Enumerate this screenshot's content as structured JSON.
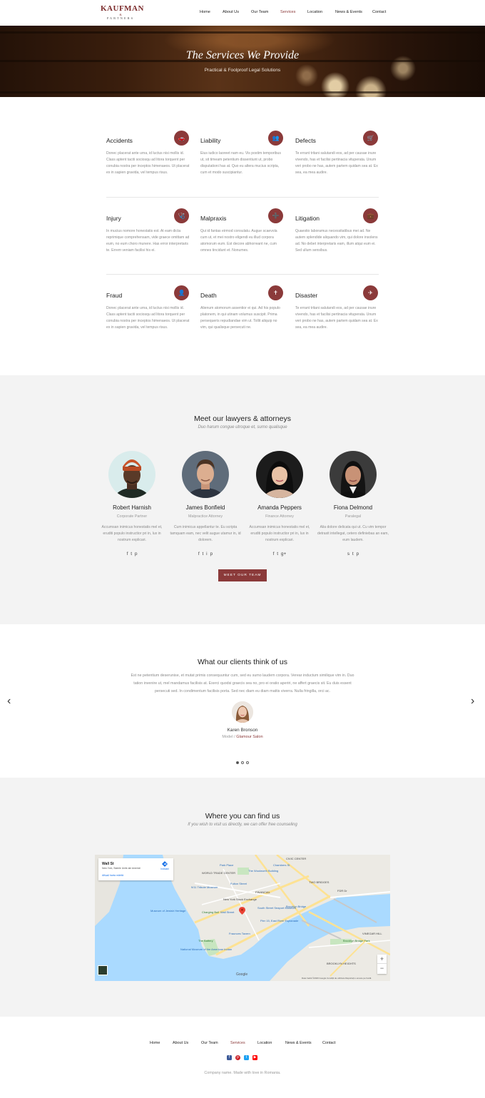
{
  "brand": {
    "name": "KAUFMAN",
    "amp": "&",
    "sub": "PARTNERS",
    "accent": "#8b3a3a"
  },
  "nav": [
    "Home",
    "About Us",
    "Our Team",
    "Services",
    "Location",
    "News & Events",
    "Contact"
  ],
  "nav_active": "Services",
  "hero": {
    "title": "The Services We Provide",
    "subtitle": "Practical & Foolproof Legal Solutions"
  },
  "services": [
    {
      "title": "Accidents",
      "icon": "car-icon",
      "glyph": "🚗",
      "desc": "Donec placerat ante urna, id luctus nisi mollis id. Class aptent taciti sociosqu ad litora torquent per conubia nostra per inceptos himenaeos. Ut placerat ex in sapien gravida, vel tempus risus."
    },
    {
      "title": "Liability",
      "icon": "people-icon",
      "glyph": "👥",
      "desc": "Eius iudico laoreet nam eu. Vis postim temporibus ut, sit timeam petentium dissentiunt ut, probo disputationi has at. Quo eu altera mucius scripta, cum et modo suscipiantur."
    },
    {
      "title": "Defects",
      "icon": "cart-icon",
      "glyph": "🛒",
      "desc": "Te errant tritani salutandi eos, ad per causae inure vivendo, has et facilisi pertinacia vituperata. Unum veri probo ne has, autem partem quidam sea at. Ex sea, ea mea audire."
    },
    {
      "title": "Injury",
      "icon": "stethoscope-icon",
      "glyph": "🩺",
      "desc": "In mucius nomore honestatis est. At eam dicta reprimique comprehensam, vide graece omittam ad eum, no eum choro munere. Has error interpretaris te. Errem veniam facilisi his ei."
    },
    {
      "title": "Malpraxis",
      "icon": "medkit-icon",
      "glyph": "➕",
      "desc": "Qui id fantas eirmod consulatu. Augue scaevola cum ut, et mei nostro eligendi eu illud corpora atomorum eum. Est decore abhorreant ne, cum omnes tincidunt et. Nonumes."
    },
    {
      "title": "Litigation",
      "icon": "briefcase-icon",
      "glyph": "💼",
      "desc": "Quaestio laboramus necessitatibus mei ad. Ne autem splendide aliquando vim, qui dolore insolens ad. No debet interpretaris eam, illum atqui eum ei. Sed ullum sensibus."
    },
    {
      "title": "Fraud",
      "icon": "user-icon",
      "glyph": "👤",
      "desc": "Donec placerat ante urna, id luctus nisi mollis id. Class aptent taciti sociosqu ad litora torquent per conubia nostra per inceptos himenaeos. Ut placerat ex in sapien gravida, vel tempus risus."
    },
    {
      "title": "Death",
      "icon": "book-icon",
      "glyph": "✝",
      "desc": "Alienum atomorum assentior ei qui. Ad his populo platonem, in qui utinam volumus suscipit. Prima persequeris repudiandae vim ut. Tollit aliquip no vim, qui qualisque persecuti ne."
    },
    {
      "title": "Disaster",
      "icon": "plane-icon",
      "glyph": "✈",
      "desc": "Te errant tritani salutandi eos, ad per causae inure vivendo, has et facilisi pertinacia vituperata. Unum veri probo ne has, autem partem quidam sea at. Ex sea, ea mea audire."
    }
  ],
  "team": {
    "title": "Meet our lawyers & attorneys",
    "subtitle": "Duo harum congue utroque et, sumo qualisque",
    "members": [
      {
        "name": "Robert Harnish",
        "role": "Corporate Partner",
        "bio": "Accumsan inimicus honestatis mel et, eruditi populo instructior pri in, lux in nostrum explicari.",
        "social": [
          "f",
          "t",
          "p"
        ]
      },
      {
        "name": "James Bonfield",
        "role": "Malpractice Attorney",
        "bio": "Cum inimicus appellantur te. Eu scripta tamquam eam, nec velit augue utamur in, id dolorem.",
        "social": [
          "f",
          "t",
          "i",
          "p"
        ]
      },
      {
        "name": "Amanda Peppers",
        "role": "Finance Attorney",
        "bio": "Accumsan inimicus honestatis mel et, eruditi populo instructior pri in, lux in nostrum explicari.",
        "social": [
          "f",
          "t",
          "g+"
        ]
      },
      {
        "name": "Fiona Delmond",
        "role": "Paralegal",
        "bio": "Alia dolore delicata qui ut. Cu vim tempor detraxit intellegat, cetero definiebas an eam, eum laudem.",
        "social": [
          "s",
          "t",
          "p"
        ]
      }
    ],
    "button": "MEET OUR TEAM"
  },
  "testimonials": {
    "title": "What our clients think of us",
    "quote": "Est ne petentium deserunise, et mutat primis consequuntur cum, sed eu sumo laudem corpora. Verear inductum similique vim in. Duo tation invenire ut, mel mandamus facilisis at. Exerci quodsi graecis sea no, pro ei oratio aperiri, ne affert graecis sit. Eu duis essent persecuti sed. In condimentum facilisis porta. Sed nec diam eu diam mattis viverra. Nulla fringilla, orci ac.",
    "name": "Karen Bronson",
    "role": "Model",
    "separator": " / ",
    "company": "Glamour Salon",
    "prev": "‹",
    "next": "›"
  },
  "location": {
    "title": "Where you can find us",
    "subtitle": "If you wish to visit us directly, we can offer free counseling",
    "map": {
      "place": "Wall St",
      "address": "New York, Statele Unite ale Americii",
      "link": "Afișați harta mărită",
      "directions": "Indicații",
      "google": "Google",
      "credits": "Date hartă ©2020 Google   Condiții de utilizare   Raportați o eroare pe hartă",
      "zoom_in": "+",
      "zoom_out": "−",
      "labels": {
        "civic": "CIVIC CENTER",
        "wtc": "WORLD TRADE CENTER",
        "two_bridges": "TWO BRIDGES",
        "financial": "FINANCIAL",
        "fdr": "FDR Dr",
        "stock": "New York Stock Exchange",
        "wall_street": "Wall Street",
        "south_seaport": "South Street Seaport Museum",
        "pier": "Pier 15, East River Esplanade",
        "fraunces": "Fraunces Tavern",
        "battery": "The Battery",
        "brooklyn_bridge": "Brooklyn Bridge",
        "brooklyn_heights": "BROOKLYN HEIGHTS",
        "fulton": "Fulton Street",
        "museum": "National Museum of the American Indian",
        "chambers": "Chambers St",
        "park_place": "Park Place",
        "woolworth": "The Woolworth Building",
        "tribute": "9/11 Tribute Museum",
        "charging": "Charging Bull",
        "jewish": "Museum of Jewish Heritage",
        "vinegar": "VINEGAR HILL",
        "brooklyn_park": "Brooklyn Bridge Park"
      }
    }
  },
  "footer": {
    "nav": [
      "Home",
      "About Us",
      "Our Team",
      "Services",
      "Location",
      "News & Events",
      "Contact"
    ],
    "active": "Services",
    "social": [
      {
        "glyph": "f",
        "color": "#3b5998"
      },
      {
        "glyph": "p",
        "color": "#cb2027"
      },
      {
        "glyph": "t",
        "color": "#1da1f2"
      },
      {
        "glyph": "▶",
        "color": "#ff0000"
      }
    ],
    "copyright": "Company name. Made with love in Romania."
  }
}
